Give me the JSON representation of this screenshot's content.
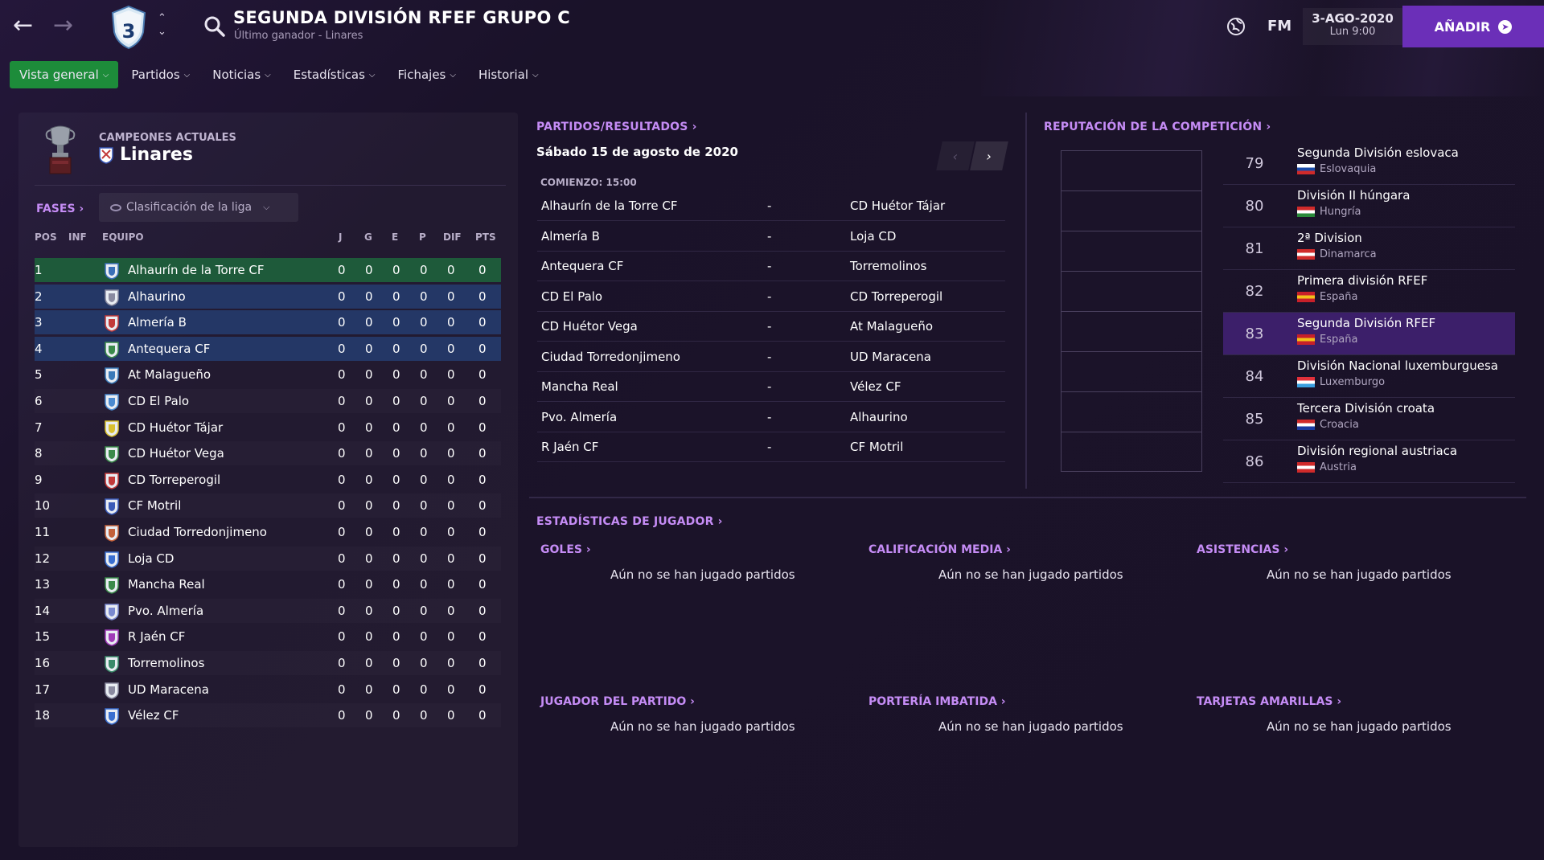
{
  "header": {
    "competition_title": "SEGUNDA DIVISIÓN RFEF GRUPO C",
    "competition_subtitle": "Último ganador - Linares",
    "shield_number": "3",
    "fm_logo": "FM",
    "date": "3-AGO-2020",
    "time": "Lun 9:00",
    "add_button": "AÑADIR",
    "icons": [
      "back-arrow-icon",
      "forward-arrow-icon",
      "up-down-chevron-icon",
      "search-icon",
      "globe-icon",
      "plus-circle-icon"
    ]
  },
  "tabs": [
    {
      "label": "Vista general",
      "active": true
    },
    {
      "label": "Partidos"
    },
    {
      "label": "Noticias"
    },
    {
      "label": "Estadísticas"
    },
    {
      "label": "Fichajes"
    },
    {
      "label": "Historial"
    }
  ],
  "champions": {
    "label": "CAMPEONES ACTUALES",
    "team": "Linares"
  },
  "phases": {
    "label": "FASES",
    "dropdown": "Clasificación de la liga"
  },
  "table": {
    "headers": {
      "pos": "POS",
      "inf": "INF",
      "team": "EQUIPO",
      "j": "J",
      "g": "G",
      "e": "E",
      "p": "P",
      "dif": "DIF",
      "pts": "PTS"
    },
    "rows": [
      {
        "pos": "1",
        "team": "Alhaurín de la Torre CF",
        "j": "0",
        "g": "0",
        "e": "0",
        "p": "0",
        "dif": "0",
        "pts": "0",
        "zone": "green",
        "crest": "#3a6fb8"
      },
      {
        "pos": "2",
        "team": "Alhaurino",
        "j": "0",
        "g": "0",
        "e": "0",
        "p": "0",
        "dif": "0",
        "pts": "0",
        "zone": "blue",
        "crest": "#8a8aa0"
      },
      {
        "pos": "3",
        "team": "Almería B",
        "j": "0",
        "g": "0",
        "e": "0",
        "p": "0",
        "dif": "0",
        "pts": "0",
        "zone": "blue",
        "crest": "#c23a3a"
      },
      {
        "pos": "4",
        "team": "Antequera CF",
        "j": "0",
        "g": "0",
        "e": "0",
        "p": "0",
        "dif": "0",
        "pts": "0",
        "zone": "blue",
        "crest": "#3a8a4a"
      },
      {
        "pos": "5",
        "team": "At Malagueño",
        "j": "0",
        "g": "0",
        "e": "0",
        "p": "0",
        "dif": "0",
        "pts": "0",
        "crest": "#3a7ab8"
      },
      {
        "pos": "6",
        "team": "CD El Palo",
        "j": "0",
        "g": "0",
        "e": "0",
        "p": "0",
        "dif": "0",
        "pts": "0",
        "crest": "#4a8ad0"
      },
      {
        "pos": "7",
        "team": "CD Huétor Tájar",
        "j": "0",
        "g": "0",
        "e": "0",
        "p": "0",
        "dif": "0",
        "pts": "0",
        "crest": "#d8c030"
      },
      {
        "pos": "8",
        "team": "CD Huétor Vega",
        "j": "0",
        "g": "0",
        "e": "0",
        "p": "0",
        "dif": "0",
        "pts": "0",
        "crest": "#3a8a4a"
      },
      {
        "pos": "9",
        "team": "CD Torreperogil",
        "j": "0",
        "g": "0",
        "e": "0",
        "p": "0",
        "dif": "0",
        "pts": "0",
        "crest": "#c23a3a"
      },
      {
        "pos": "10",
        "team": "CF Motril",
        "j": "0",
        "g": "0",
        "e": "0",
        "p": "0",
        "dif": "0",
        "pts": "0",
        "crest": "#3a5ab8"
      },
      {
        "pos": "11",
        "team": "Ciudad Torredonjimeno",
        "j": "0",
        "g": "0",
        "e": "0",
        "p": "0",
        "dif": "0",
        "pts": "0",
        "crest": "#c2603a"
      },
      {
        "pos": "12",
        "team": "Loja CD",
        "j": "0",
        "g": "0",
        "e": "0",
        "p": "0",
        "dif": "0",
        "pts": "0",
        "crest": "#3a6fd0"
      },
      {
        "pos": "13",
        "team": "Mancha Real",
        "j": "0",
        "g": "0",
        "e": "0",
        "p": "0",
        "dif": "0",
        "pts": "0",
        "crest": "#3a8a4a"
      },
      {
        "pos": "14",
        "team": "Pvo. Almería",
        "j": "0",
        "g": "0",
        "e": "0",
        "p": "0",
        "dif": "0",
        "pts": "0",
        "crest": "#7a8ad0"
      },
      {
        "pos": "15",
        "team": "R Jaén CF",
        "j": "0",
        "g": "0",
        "e": "0",
        "p": "0",
        "dif": "0",
        "pts": "0",
        "crest": "#a03ab8"
      },
      {
        "pos": "16",
        "team": "Torremolinos",
        "j": "0",
        "g": "0",
        "e": "0",
        "p": "0",
        "dif": "0",
        "pts": "0",
        "crest": "#3a8a6a"
      },
      {
        "pos": "17",
        "team": "UD Maracena",
        "j": "0",
        "g": "0",
        "e": "0",
        "p": "0",
        "dif": "0",
        "pts": "0",
        "crest": "#8a8aa0"
      },
      {
        "pos": "18",
        "team": "Vélez CF",
        "j": "0",
        "g": "0",
        "e": "0",
        "p": "0",
        "dif": "0",
        "pts": "0",
        "crest": "#3a6fd0"
      }
    ]
  },
  "fixtures": {
    "title": "PARTIDOS/RESULTADOS",
    "date": "Sábado 15 de agosto de 2020",
    "kickoff": "COMIENZO: 15:00",
    "matches": [
      {
        "home": "Alhaurín de la Torre CF",
        "sep": "-",
        "away": "CD Huétor Tájar"
      },
      {
        "home": "Almería B",
        "sep": "-",
        "away": "Loja CD"
      },
      {
        "home": "Antequera CF",
        "sep": "-",
        "away": "Torremolinos"
      },
      {
        "home": "CD El Palo",
        "sep": "-",
        "away": "CD Torreperogil"
      },
      {
        "home": "CD Huétor Vega",
        "sep": "-",
        "away": "At Malagueño"
      },
      {
        "home": "Ciudad Torredonjimeno",
        "sep": "-",
        "away": "UD Maracena"
      },
      {
        "home": "Mancha Real",
        "sep": "-",
        "away": "Vélez CF"
      },
      {
        "home": "Pvo. Almería",
        "sep": "-",
        "away": "Alhaurino"
      },
      {
        "home": "R Jaén CF",
        "sep": "-",
        "away": "CF Motril"
      }
    ]
  },
  "reputation": {
    "title": "REPUTACIÓN DE LA COMPETICIÓN",
    "entries": [
      {
        "rank": "79",
        "name": "Segunda División eslovaca",
        "country": "Eslovaquia",
        "flag": [
          "#ffffff",
          "#1a4aa8",
          "#d02a2a"
        ]
      },
      {
        "rank": "80",
        "name": "División II húngara",
        "country": "Hungría",
        "flag": [
          "#d02a2a",
          "#ffffff",
          "#2a8a3a"
        ]
      },
      {
        "rank": "81",
        "name": "2ª Division",
        "country": "Dinamarca",
        "flag": [
          "#d02a2a",
          "#ffffff",
          "#d02a2a"
        ]
      },
      {
        "rank": "82",
        "name": "Primera división RFEF",
        "country": "España",
        "flag": [
          "#c8202a",
          "#f2c21a",
          "#c8202a"
        ]
      },
      {
        "rank": "83",
        "name": "Segunda División RFEF",
        "country": "España",
        "flag": [
          "#c8202a",
          "#f2c21a",
          "#c8202a"
        ],
        "highlight": true
      },
      {
        "rank": "84",
        "name": "División Nacional luxemburguesa",
        "country": "Luxemburgo",
        "flag": [
          "#e2303a",
          "#ffffff",
          "#3aa0e0"
        ]
      },
      {
        "rank": "85",
        "name": "Tercera División croata",
        "country": "Croacia",
        "flag": [
          "#d02a2a",
          "#ffffff",
          "#1a3aa0"
        ]
      },
      {
        "rank": "86",
        "name": "División regional austriaca",
        "country": "Austria",
        "flag": [
          "#d02a2a",
          "#ffffff",
          "#d02a2a"
        ]
      }
    ]
  },
  "player_stats": {
    "title": "ESTADÍSTICAS DE JUGADOR",
    "sections": [
      {
        "title": "GOLES",
        "empty": "Aún no se han jugado partidos"
      },
      {
        "title": "CALIFICACIÓN MEDIA",
        "empty": "Aún no se han jugado partidos"
      },
      {
        "title": "ASISTENCIAS",
        "empty": "Aún no se han jugado partidos"
      },
      {
        "title": "JUGADOR DEL PARTIDO",
        "empty": "Aún no se han jugado partidos"
      },
      {
        "title": "PORTERÍA IMBATIDA",
        "empty": "Aún no se han jugado partidos"
      },
      {
        "title": "TARJETAS AMARILLAS",
        "empty": "Aún no se han jugado partidos"
      }
    ]
  },
  "colors": {
    "accent": "#c58cf5",
    "add_button": "#6b2fb8",
    "active_tab": "#1d8c3a",
    "promotion_zone": "#1e5a3a",
    "playoff_zone": "#243766",
    "highlight_row": "#3c1f6a"
  }
}
